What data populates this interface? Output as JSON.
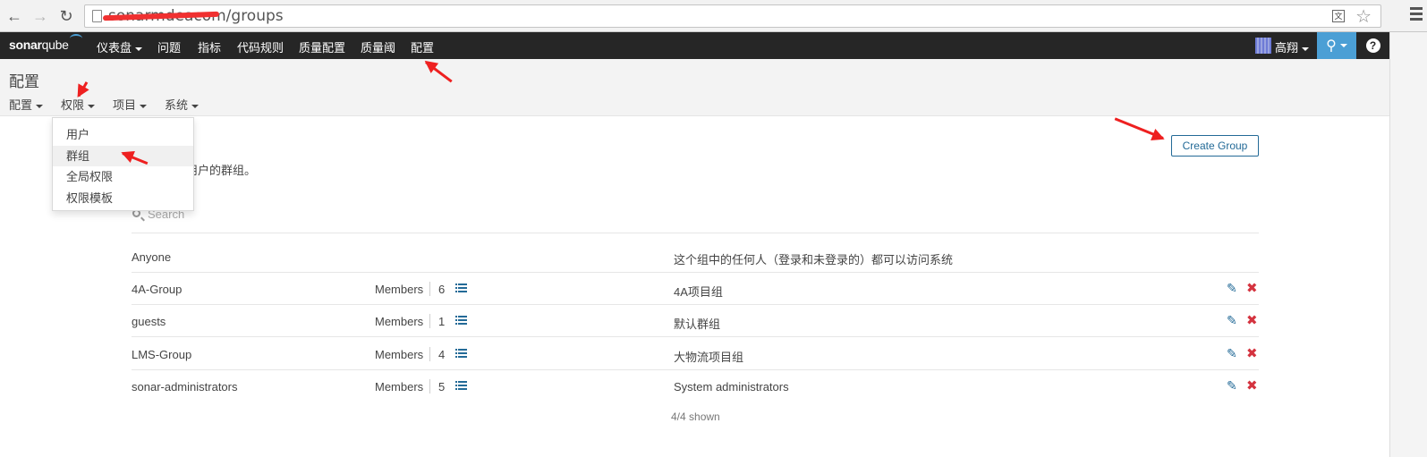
{
  "browser": {
    "url": "sonarmdeacom/groups",
    "url_visible_suffix": "/groups"
  },
  "topnav": {
    "logo": "sonarqube",
    "items": [
      {
        "label": "仪表盘",
        "has_caret": true
      },
      {
        "label": "问题"
      },
      {
        "label": "指标"
      },
      {
        "label": "代码规则"
      },
      {
        "label": "质量配置"
      },
      {
        "label": "质量阈"
      },
      {
        "label": "配置"
      }
    ],
    "user": "高翔",
    "help": "?"
  },
  "header": {
    "title": "配置",
    "tabs": [
      {
        "label": "配置"
      },
      {
        "label": "权限"
      },
      {
        "label": "项目"
      },
      {
        "label": "系统"
      }
    ]
  },
  "dropdown": {
    "items": [
      "用户",
      "群组",
      "全局权限",
      "权限模板"
    ]
  },
  "content": {
    "description": "用户的群组。",
    "create_button": "Create Group",
    "search_placeholder": "Search",
    "members_label": "Members",
    "groups": [
      {
        "name": "Anyone",
        "description": "这个组中的任何人（登录和未登录的）都可以访问系统"
      },
      {
        "name": "4A-Group",
        "members": "6",
        "description": "4A项目组"
      },
      {
        "name": "guests",
        "members": "1",
        "description": "默认群组"
      },
      {
        "name": "LMS-Group",
        "members": "4",
        "description": "大物流项目组"
      },
      {
        "name": "sonar-administrators",
        "members": "5",
        "description": "System administrators"
      }
    ],
    "shown": "4/4 shown"
  },
  "colors": {
    "nav_bg": "#262626",
    "accent": "#4b9fd5",
    "link": "#236a97",
    "danger": "#d4333f",
    "annotation": "#ee2020"
  }
}
